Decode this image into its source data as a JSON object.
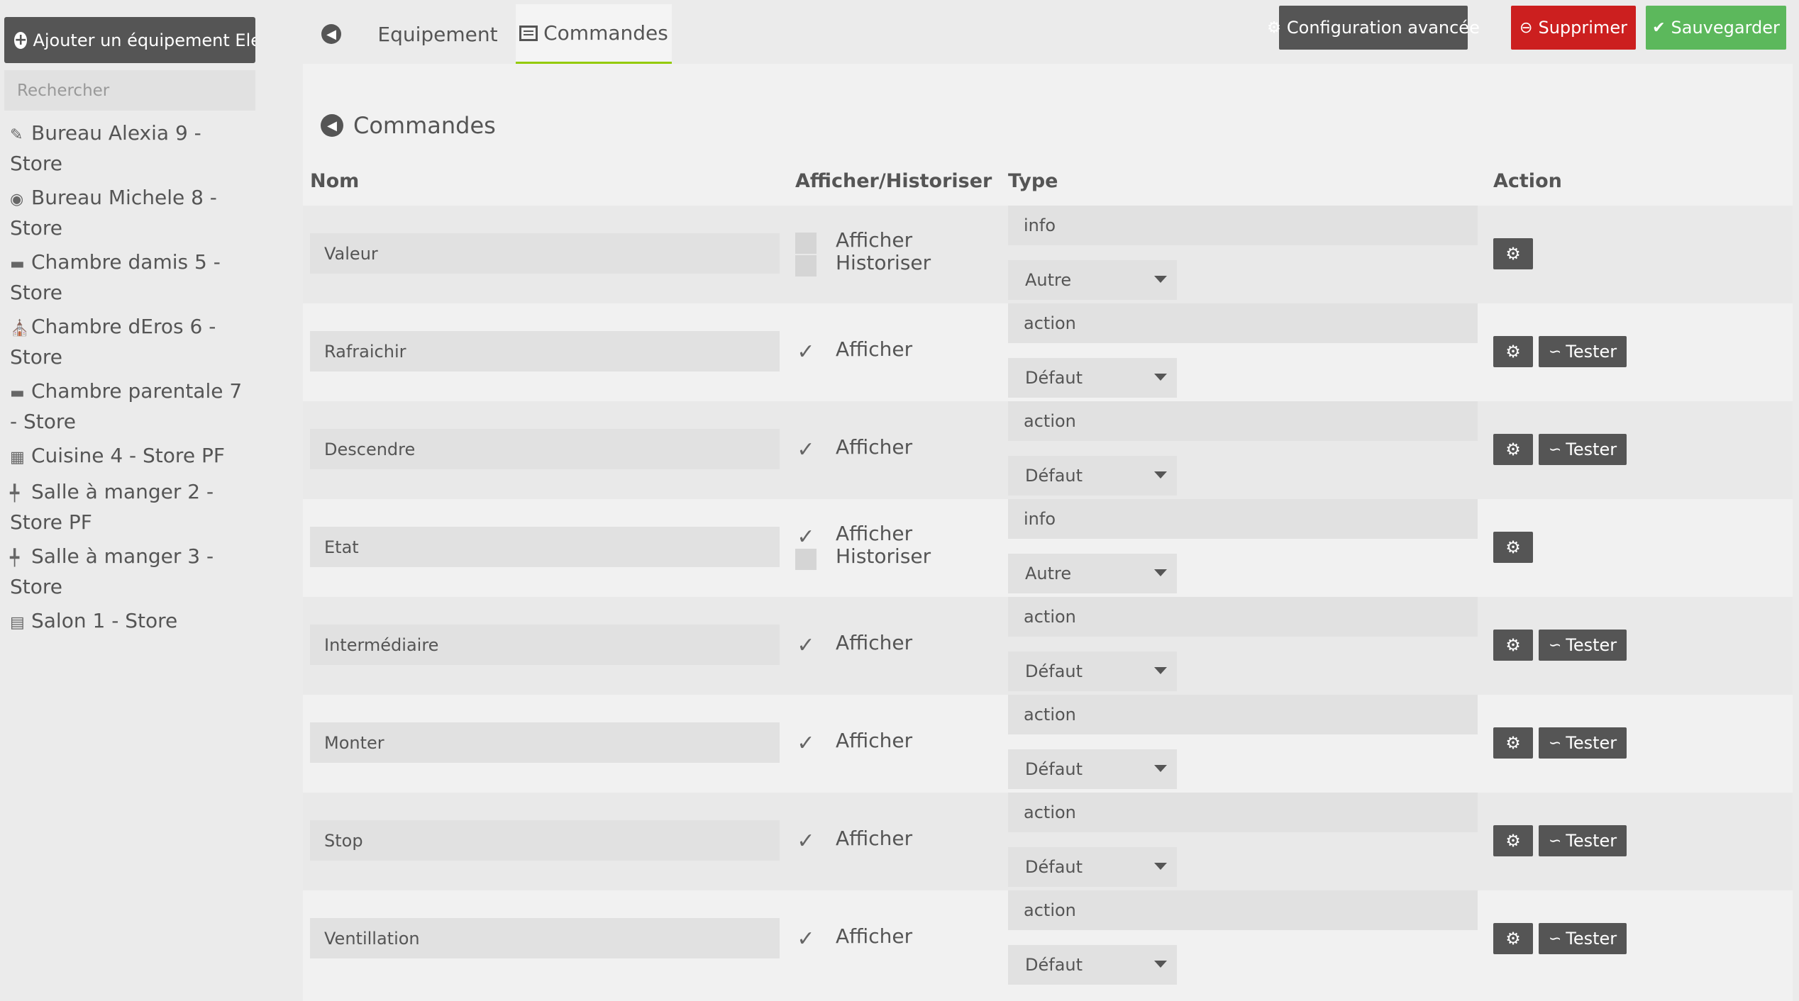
{
  "sidebar": {
    "add_button_label": "Ajouter un équipement Elero",
    "search_placeholder": "Rechercher",
    "items": [
      {
        "label": "Bureau Alexia 9 - Store",
        "icon": "desk-icon"
      },
      {
        "label": "Bureau Michele 8 - Store",
        "icon": "gamepad-icon"
      },
      {
        "label": "Chambre damis 5 - Store",
        "icon": "bed-icon"
      },
      {
        "label": "Chambre dEros 6 - Store",
        "icon": "child-room-icon"
      },
      {
        "label": "Chambre parentale 7 - Store",
        "icon": "bed-icon"
      },
      {
        "label": "Cuisine 4 - Store PF",
        "icon": "kitchen-icon"
      },
      {
        "label": "Salle à manger 2 - Store PF",
        "icon": "dining-table-icon"
      },
      {
        "label": "Salle à manger 3 - Store",
        "icon": "dining-table-icon"
      },
      {
        "label": "Salon 1 - Store",
        "icon": "sofa-icon"
      }
    ]
  },
  "tabs": {
    "equipement": "Equipement",
    "commandes": "Commandes"
  },
  "toolbar": {
    "config_label": "Configuration avancée",
    "delete_label": "Supprimer",
    "save_label": "Sauvegarder"
  },
  "panel": {
    "title": "Commandes",
    "columns": {
      "nom": "Nom",
      "afficher": "Afficher/Historiser",
      "type": "Type",
      "action": "Action"
    },
    "afficher_label": "Afficher",
    "historiser_label": "Historiser",
    "test_label": "Tester",
    "rows": [
      {
        "name": "Valeur",
        "type": "info",
        "subtype": "Autre",
        "afficher": false,
        "historiser": false,
        "show_historiser": true,
        "testable": false
      },
      {
        "name": "Rafraichir",
        "type": "action",
        "subtype": "Défaut",
        "afficher": true,
        "historiser": false,
        "show_historiser": false,
        "testable": true
      },
      {
        "name": "Descendre",
        "type": "action",
        "subtype": "Défaut",
        "afficher": true,
        "historiser": false,
        "show_historiser": false,
        "testable": true
      },
      {
        "name": "Etat",
        "type": "info",
        "subtype": "Autre",
        "afficher": true,
        "historiser": false,
        "show_historiser": true,
        "testable": false
      },
      {
        "name": "Intermédiaire",
        "type": "action",
        "subtype": "Défaut",
        "afficher": true,
        "historiser": false,
        "show_historiser": false,
        "testable": true
      },
      {
        "name": "Monter",
        "type": "action",
        "subtype": "Défaut",
        "afficher": true,
        "historiser": false,
        "show_historiser": false,
        "testable": true
      },
      {
        "name": "Stop",
        "type": "action",
        "subtype": "Défaut",
        "afficher": true,
        "historiser": false,
        "show_historiser": false,
        "testable": true
      },
      {
        "name": "Ventillation",
        "type": "action",
        "subtype": "Défaut",
        "afficher": true,
        "historiser": false,
        "show_historiser": false,
        "testable": true
      }
    ]
  },
  "colors": {
    "accent_green": "#94ca02",
    "danger": "#cc1f1f",
    "success": "#5cb85c",
    "dark": "#555555"
  }
}
